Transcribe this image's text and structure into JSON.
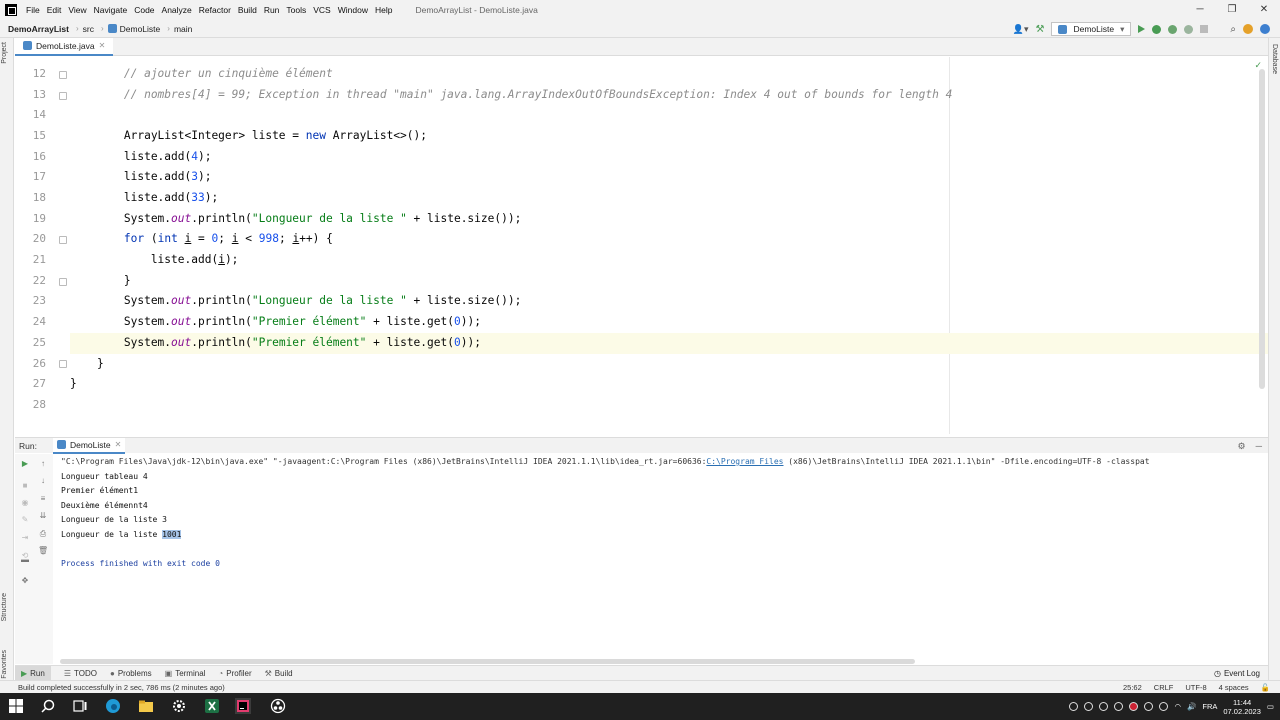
{
  "menu": {
    "items": [
      "File",
      "Edit",
      "View",
      "Navigate",
      "Code",
      "Analyze",
      "Refactor",
      "Build",
      "Run",
      "Tools",
      "VCS",
      "Window",
      "Help"
    ],
    "window_title": "DemoArrayList - DemoListe.java"
  },
  "window_controls": {
    "minimize": "─",
    "maximize": "❐",
    "close": "✕"
  },
  "breadcrumb": {
    "project": "DemoArrayList",
    "folder": "src",
    "class": "DemoListe",
    "method": "main"
  },
  "toolbar": {
    "run_config": "DemoListe"
  },
  "side_panels": {
    "project": "Project",
    "structure": "Structure",
    "favorites": "Favorites",
    "database": "Database"
  },
  "editor": {
    "tab_label": "DemoListe.java",
    "line_numbers": [
      "12",
      "13",
      "14",
      "15",
      "16",
      "17",
      "18",
      "19",
      "20",
      "21",
      "22",
      "23",
      "24",
      "25",
      "26",
      "27",
      "28"
    ]
  },
  "run_panel": {
    "label": "Run:",
    "tab_label": "DemoListe",
    "command_parts": {
      "p1": "\"C:\\Program Files\\Java\\jdk-12\\bin\\java.exe\" \"-javaagent:C:\\Program Files (x86)\\JetBrains\\IntelliJ IDEA 2021.1.1\\lib\\idea_rt.jar=60636:",
      "link": "C:\\Program Files",
      "p2": " (x86)\\JetBrains\\IntelliJ IDEA 2021.1.1\\bin\" -Dfile.encoding=UTF-8 -classpat"
    },
    "output": [
      "Longueur tableau 4",
      "Premier élément1",
      "Deuxième élémennt4",
      "Longueur de la liste 3"
    ],
    "last_line_prefix": "Longueur de la liste ",
    "last_line_value": "1001",
    "finish": "Process finished with exit code 0"
  },
  "bottom_tabs": [
    "Run",
    "TODO",
    "Problems",
    "Terminal",
    "Profiler",
    "Build"
  ],
  "event_log": "Event Log",
  "status": {
    "message": "Build completed successfully in 2 sec, 786 ms (2 minutes ago)",
    "position": "25:62",
    "line_sep": "CRLF",
    "encoding": "UTF-8",
    "indent": "4 spaces"
  },
  "taskbar": {
    "lang": "FRA",
    "time": "11:44",
    "date": "07.02.2023"
  }
}
